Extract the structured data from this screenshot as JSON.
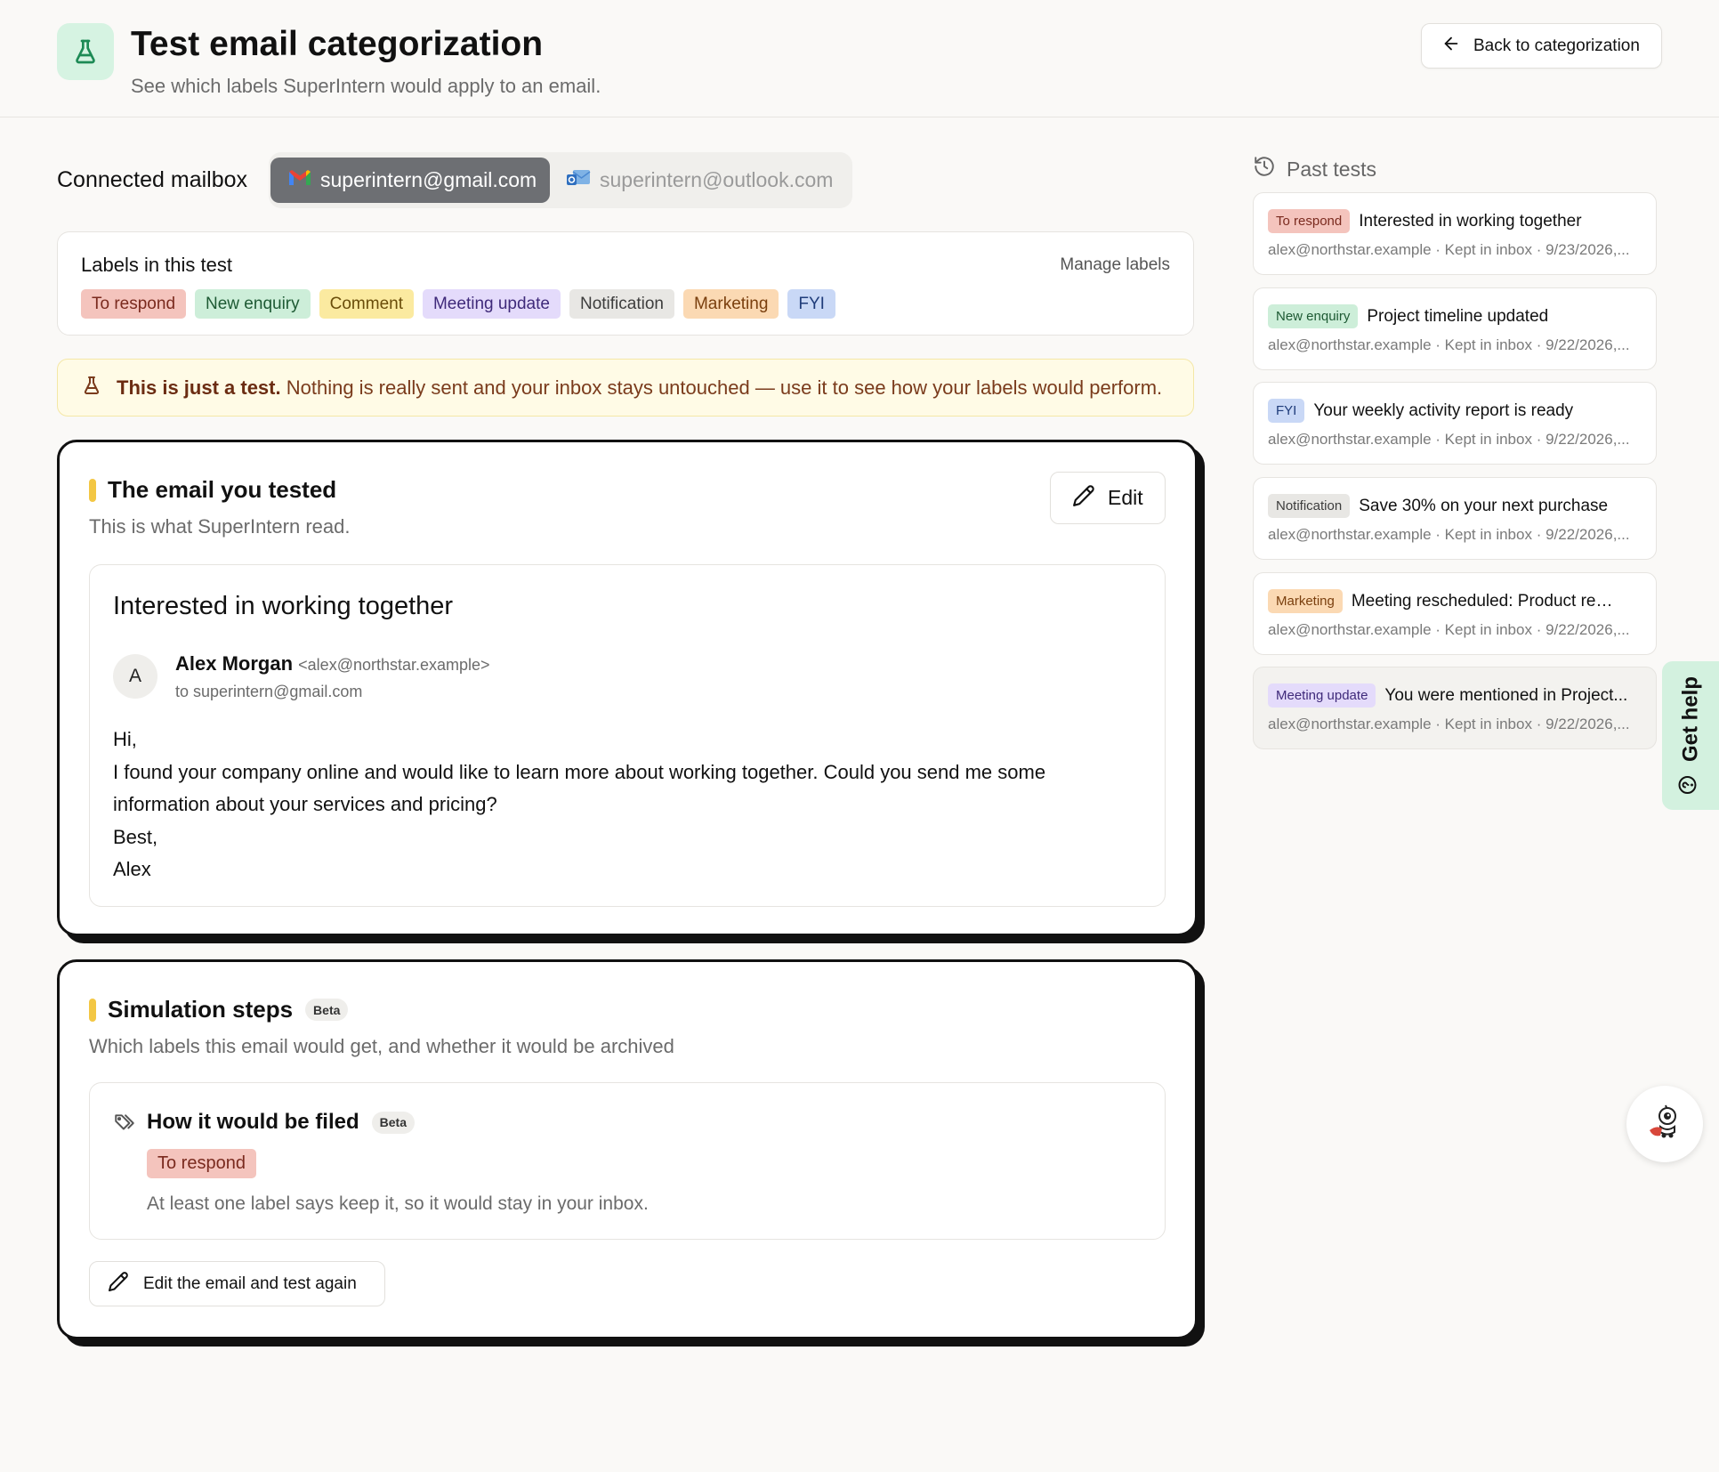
{
  "header": {
    "title": "Test email categorization",
    "subtitle": "See which labels SuperIntern would apply to an email.",
    "back_label": "Back to categorization"
  },
  "mailbox": {
    "label": "Connected mailbox",
    "active": "superintern@gmail.com",
    "inactive": "superintern@outlook.com"
  },
  "labels_card": {
    "title": "Labels in this test",
    "manage": "Manage labels",
    "chips": [
      {
        "label": "To respond",
        "bg": "#f4c4bd",
        "fg": "#7a2a1e"
      },
      {
        "label": "New enquiry",
        "bg": "#cdeed9",
        "fg": "#1e5a34"
      },
      {
        "label": "Comment",
        "bg": "#fbeaa0",
        "fg": "#6a4d0a"
      },
      {
        "label": "Meeting update",
        "bg": "#e4dbfb",
        "fg": "#3f2a7a"
      },
      {
        "label": "Notification",
        "bg": "#e8e7e4",
        "fg": "#3d3d3d"
      },
      {
        "label": "Marketing",
        "bg": "#fbd9b3",
        "fg": "#7a3f0e"
      },
      {
        "label": "FYI",
        "bg": "#c9d8f6",
        "fg": "#1f3c7a"
      }
    ]
  },
  "banner": {
    "bold": "This is just a test.",
    "text": "Nothing is really sent and your inbox stays untouched — use it to see how your labels would perform."
  },
  "email_card": {
    "title": "The email you tested",
    "subtitle": "This is what SuperIntern read.",
    "edit_label": "Edit",
    "subject": "Interested in working together",
    "avatar": "A",
    "sender_name": "Alex Morgan",
    "sender_email": "<alex@northstar.example>",
    "to": "to superintern@gmail.com",
    "body": [
      "Hi,",
      "I found your company online and would like to learn more about working together. Could you send me some information about your services and pricing?",
      "Best,",
      "Alex"
    ]
  },
  "sim_card": {
    "title": "Simulation steps",
    "beta": "Beta",
    "subtitle": "Which labels this email would get, and whether it would be archived",
    "filed_title": "How it would be filed",
    "filed_beta": "Beta",
    "filed_label": "To respond",
    "filed_desc": "At least one label says keep it, so it would stay in your inbox.",
    "retest_label": "Edit the email and test again"
  },
  "past_tests": {
    "title": "Past tests",
    "items": [
      {
        "label": "To respond",
        "bg": "#f4c4bd",
        "fg": "#7a2a1e",
        "subject": "Interested in working together",
        "meta": "alex@northstar.example · Kept in inbox · 9/23/2026,..."
      },
      {
        "label": "New enquiry",
        "bg": "#cdeed9",
        "fg": "#1e5a34",
        "subject": "Project timeline updated",
        "meta": "alex@northstar.example · Kept in inbox · 9/22/2026,..."
      },
      {
        "label": "FYI",
        "bg": "#c9d8f6",
        "fg": "#1f3c7a",
        "subject": "Your weekly activity report is ready",
        "meta": "alex@northstar.example · Kept in inbox · 9/22/2026,..."
      },
      {
        "label": "Notification",
        "bg": "#e8e7e4",
        "fg": "#3d3d3d",
        "subject": "Save 30% on your next purchase",
        "meta": "alex@northstar.example · Kept in inbox · 9/22/2026,..."
      },
      {
        "label": "Marketing",
        "bg": "#fbd9b3",
        "fg": "#7a3f0e",
        "subject": "Meeting rescheduled: Product review",
        "meta": "alex@northstar.example · Kept in inbox · 9/22/2026,..."
      },
      {
        "label": "Meeting update",
        "bg": "#e4dbfb",
        "fg": "#3f2a7a",
        "subject": "You were mentioned in Project...",
        "meta": "alex@northstar.example · Kept in inbox · 9/22/2026,..."
      }
    ]
  },
  "help": {
    "label": "Get help"
  }
}
